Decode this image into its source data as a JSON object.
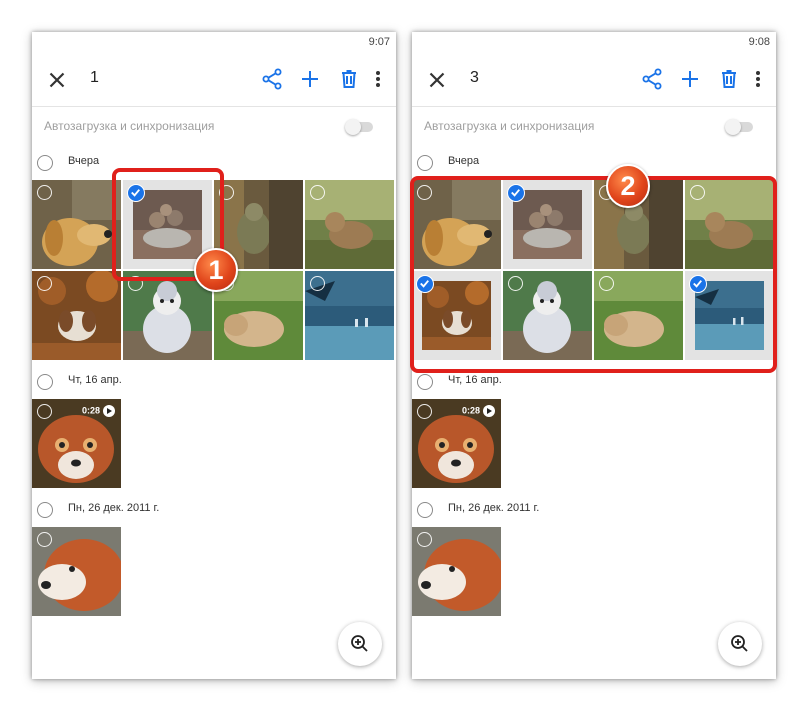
{
  "left_screen": {
    "time": "9:07",
    "selected_count": "1",
    "sync_label": "Автозагрузка и синхронизация",
    "sections": [
      "Вчера",
      "Чт, 16 апр.",
      "Пн, 26 дек. 2011 г."
    ],
    "video_duration": "0:28",
    "step_badge": "1"
  },
  "right_screen": {
    "time": "9:08",
    "selected_count": "3",
    "sync_label": "Автозагрузка и синхронизация",
    "sections": [
      "Вчера",
      "Чт, 16 апр.",
      "Пн, 26 дек. 2011 г."
    ],
    "video_duration": "0:28",
    "step_badge": "2"
  },
  "icons": {
    "close": "close-icon",
    "share": "share-icon",
    "add": "add-icon",
    "delete": "trash-icon",
    "more": "more-vert-icon",
    "zoom": "zoom-in-icon",
    "check": "check-icon",
    "play": "play-icon"
  },
  "colors": {
    "accent": "#1a73e8",
    "callout": "#e0201b",
    "badge": "#e0451b"
  }
}
